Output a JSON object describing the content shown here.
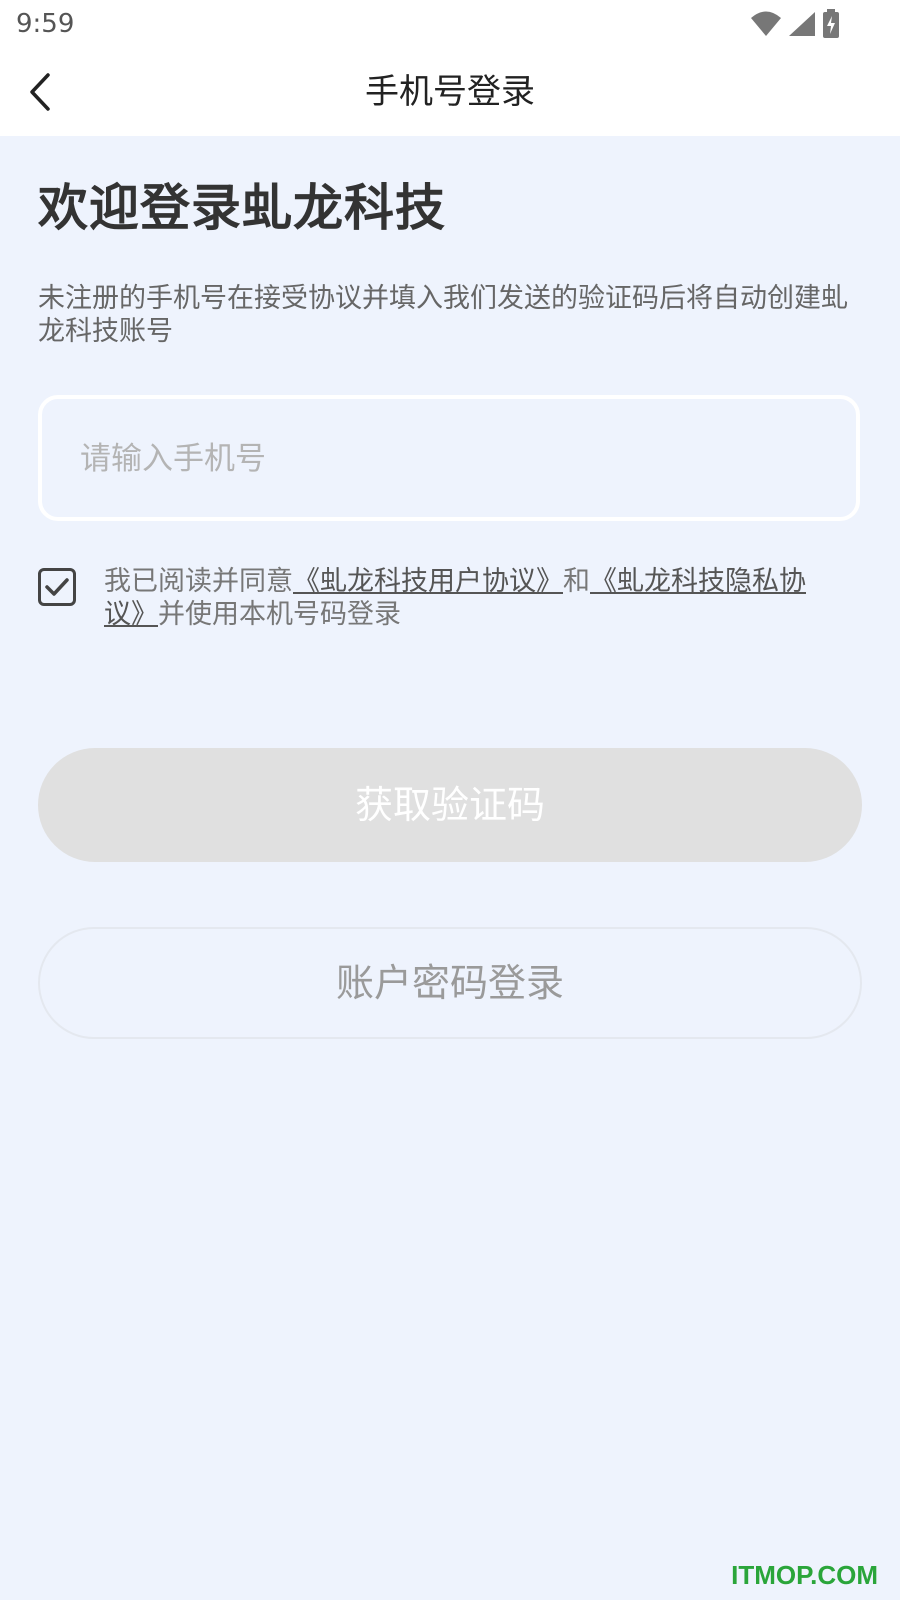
{
  "status_bar": {
    "time": "9:59",
    "icons": [
      "wifi-icon",
      "cellular-signal-icon",
      "battery-charging-icon"
    ]
  },
  "nav": {
    "title": "手机号登录",
    "back_icon": "chevron-left-icon"
  },
  "welcome": {
    "title": "欢迎登录虬龙科技",
    "description": "未注册的手机号在接受协议并填入我们发送的验证码后将自动创建虬龙科技账号"
  },
  "phone_input": {
    "value": "",
    "placeholder": "请输入手机号"
  },
  "agreement": {
    "checked": true,
    "prefix": "我已阅读并同意",
    "user_agreement_link": "《虬龙科技用户协议》",
    "conjunction": "和",
    "privacy_policy_link": "《虬龙科技隐私协议》",
    "suffix": "并使用本机号码登录"
  },
  "buttons": {
    "get_code": "获取验证码",
    "password_login": "账户密码登录"
  },
  "watermark": "ITMOP.COM",
  "colors": {
    "background": "#eef3fd",
    "disabled_button": "#e0e0e0",
    "watermark": "#2aa53a"
  }
}
